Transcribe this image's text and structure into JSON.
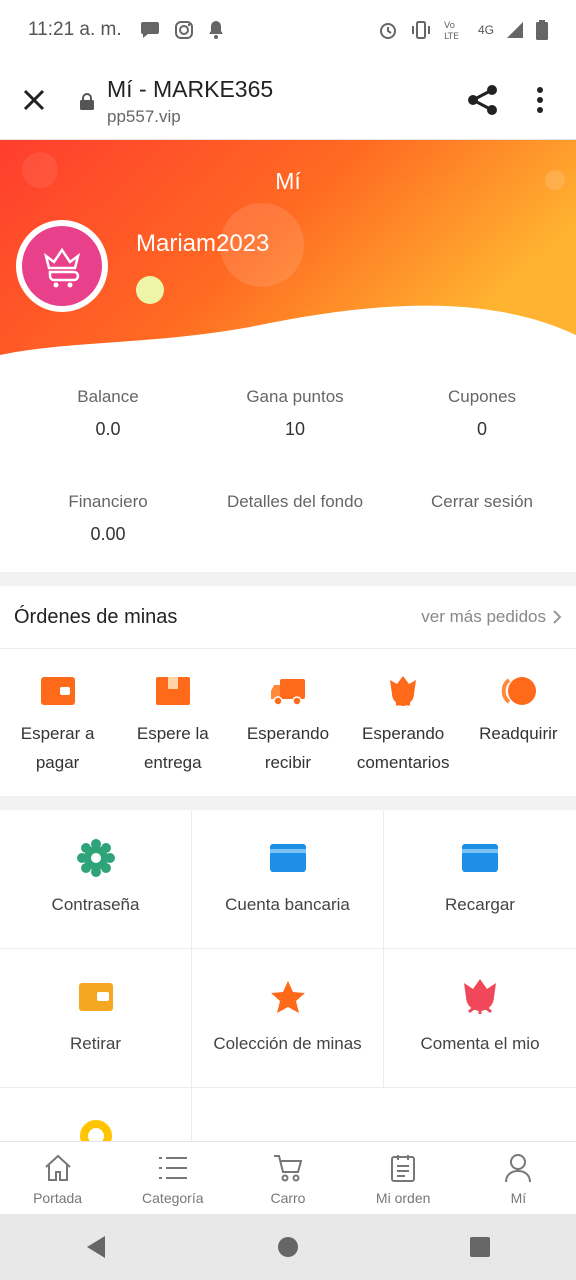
{
  "status_bar": {
    "time": "11:21 a. m.",
    "network": "4G"
  },
  "browser": {
    "title": "Mí - MARKE365",
    "url": "pp557.vip"
  },
  "header": {
    "title": "Mí",
    "username": "Mariam2023"
  },
  "stats": [
    {
      "label": "Balance",
      "value": "0.0"
    },
    {
      "label": "Gana puntos",
      "value": "10"
    },
    {
      "label": "Cupones",
      "value": "0"
    },
    {
      "label": "Financiero",
      "value": "0.00"
    },
    {
      "label": "Detalles del fondo",
      "value": ""
    },
    {
      "label": "Cerrar sesión",
      "value": ""
    }
  ],
  "orders": {
    "title": "Órdenes de minas",
    "more": "ver más pedidos",
    "items": [
      {
        "label": "Esperar a pagar",
        "icon": "wallet-icon"
      },
      {
        "label": "Espere la entrega",
        "icon": "box-icon"
      },
      {
        "label": "Esperando recibir",
        "icon": "truck-icon"
      },
      {
        "label": "Esperando comentarios",
        "icon": "flower-icon"
      },
      {
        "label": "Readquirir",
        "icon": "refund-icon"
      }
    ]
  },
  "grid": [
    {
      "label": "Contraseña",
      "icon": "gear-icon"
    },
    {
      "label": "Cuenta bancaria",
      "icon": "card-icon"
    },
    {
      "label": "Recargar",
      "icon": "card-icon"
    },
    {
      "label": "Retirar",
      "icon": "wallet-icon"
    },
    {
      "label": "Colección de minas",
      "icon": "star-icon"
    },
    {
      "label": "Comenta el mio",
      "icon": "flower-icon"
    },
    {
      "label": "",
      "icon": "circle-icon"
    }
  ],
  "tabs": [
    {
      "label": "Portada",
      "icon": "home-icon"
    },
    {
      "label": "Categoría",
      "icon": "list-icon"
    },
    {
      "label": "Carro",
      "icon": "cart-icon"
    },
    {
      "label": "Mi orden",
      "icon": "order-icon"
    },
    {
      "label": "Mí",
      "icon": "user-icon"
    }
  ],
  "colors": {
    "accent": "#ff6a1a",
    "gradient_start": "#ff3d2e",
    "gradient_end": "#ffb330"
  }
}
